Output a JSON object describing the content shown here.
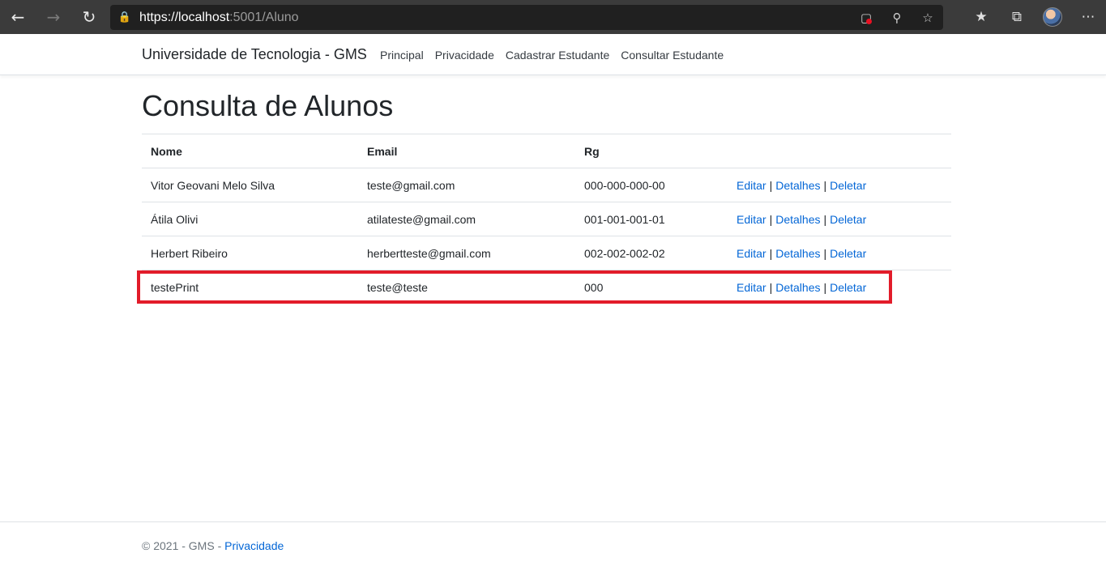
{
  "browser": {
    "back_icon": "arrow-left-icon",
    "forward_icon": "arrow-right-icon",
    "refresh_icon": "refresh-icon",
    "url_host": "https://localhost",
    "url_rest": ":5001/Aluno"
  },
  "navbar": {
    "brand": "Universidade de Tecnologia - GMS",
    "links": [
      "Principal",
      "Privacidade",
      "Cadastrar Estudante",
      "Consultar Estudante"
    ]
  },
  "main": {
    "title": "Consulta de Alunos",
    "table": {
      "headers": [
        "Nome",
        "Email",
        "Rg"
      ],
      "rows": [
        {
          "nome": "Vitor Geovani Melo Silva",
          "email": "teste@gmail.com",
          "rg": "000-000-000-00"
        },
        {
          "nome": "Átila Olivi",
          "email": "atilateste@gmail.com",
          "rg": "001-001-001-01"
        },
        {
          "nome": "Herbert Ribeiro",
          "email": "herbertteste@gmail.com",
          "rg": "002-002-002-02"
        },
        {
          "nome": "testePrint",
          "email": "teste@teste",
          "rg": "000"
        }
      ],
      "actions": {
        "edit": "Editar",
        "details": "Detalhes",
        "delete": "Deletar",
        "separator": "|"
      }
    }
  },
  "footer": {
    "text": "© 2021 - GMS - ",
    "link": "Privacidade"
  },
  "colors": {
    "link": "#0366d6",
    "highlight": "#e21c2a"
  }
}
